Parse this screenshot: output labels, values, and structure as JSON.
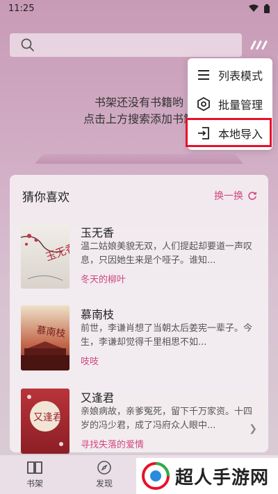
{
  "status_bar": {
    "time": "11:25"
  },
  "search": {
    "placeholder": ""
  },
  "shelf": {
    "empty_line1": "书架还没有书籍哟",
    "empty_line2": "点击上方搜索添加书籍"
  },
  "menu": {
    "items": [
      {
        "label": "列表模式",
        "icon": "list-icon"
      },
      {
        "label": "批量管理",
        "icon": "hexagon-settings-icon"
      },
      {
        "label": "本地导入",
        "icon": "import-icon"
      }
    ]
  },
  "recommend": {
    "title": "猜你喜欢",
    "refresh_label": "换一换",
    "books": [
      {
        "title": "玉无香",
        "desc": "温二姑娘美貌无双，人们提起却要道一声叹息，只因她生来是个哑子。谁知...",
        "author": "冬天的柳叶",
        "cover_text": "玉无香"
      },
      {
        "title": "慕南枝",
        "desc": "前世，李谦肖想了当朝太后姜宪一辈子。今生，李谦却觉得千里相思不如...",
        "author": "吱吱",
        "cover_text": "慕南枝"
      },
      {
        "title": "又逢君",
        "desc": "亲娘病故，亲爹冤死，留下千万家资。十四岁的冯少君，成了冯府众人眼中...",
        "author": "寻找失落的爱情",
        "cover_text": "又逢君"
      }
    ]
  },
  "tabs": [
    {
      "label": "书架",
      "icon": "book-icon"
    },
    {
      "label": "发现",
      "icon": "compass-icon"
    }
  ],
  "watermark": {
    "text": "超人手游网"
  },
  "colors": {
    "accent": "#d1487e",
    "highlight": "#e8102a"
  }
}
